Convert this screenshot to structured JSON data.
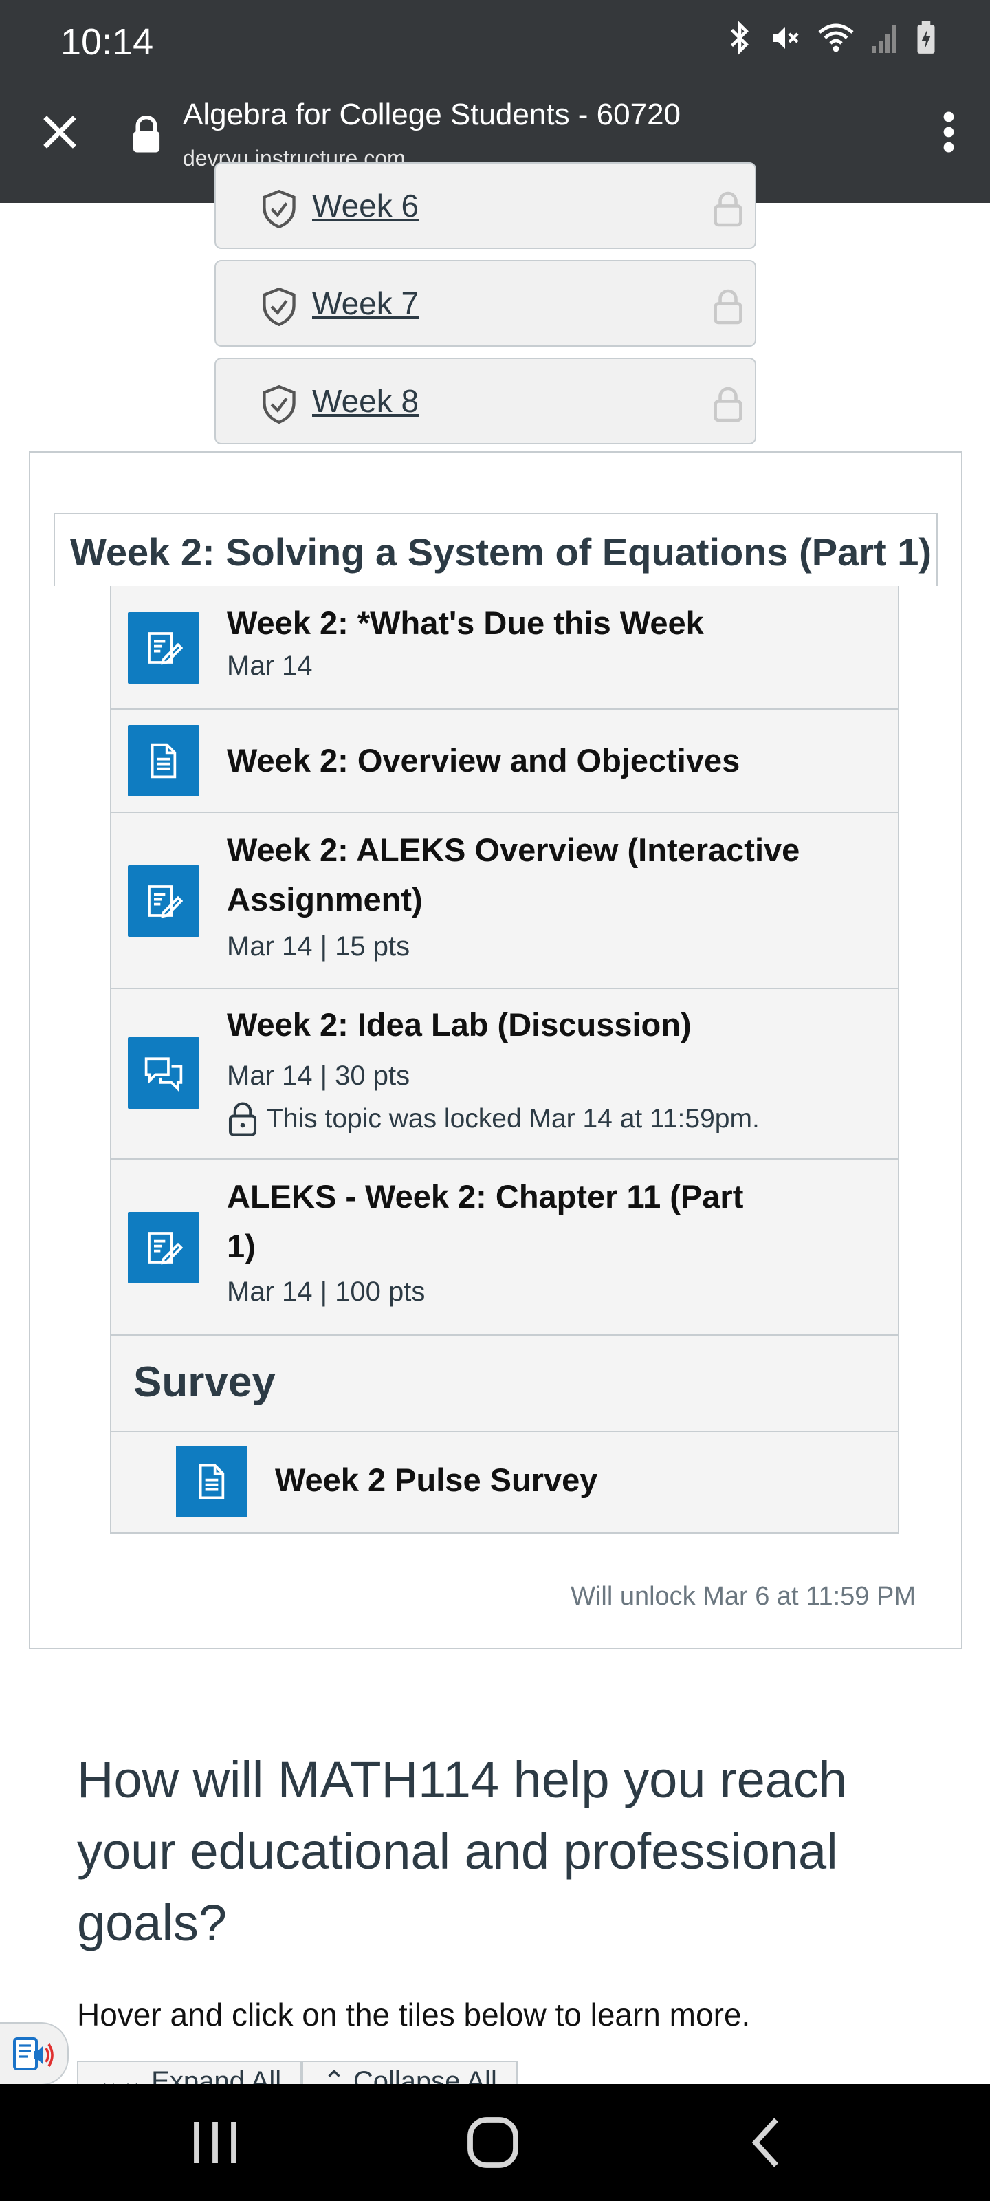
{
  "status_bar": {
    "time": "10:14",
    "icons": [
      "bluetooth-icon",
      "mute-icon",
      "wifi-icon",
      "signal-icon",
      "battery-charging-icon"
    ]
  },
  "browser": {
    "page_title": "Algebra for College Students - 60720",
    "url": "devryu.instructure.com"
  },
  "week_pills": [
    {
      "label": "Week 6",
      "locked": true
    },
    {
      "label": "Week 7",
      "locked": true
    },
    {
      "label": "Week 8",
      "locked": true
    }
  ],
  "module": {
    "title": "Week 2: Solving a System of Equations (Part 1)",
    "items": [
      {
        "title": "Week 2: *What's Due this Week",
        "meta": "Mar 14",
        "icon": "assignment-icon"
      },
      {
        "title": "Week 2: Overview and Objectives",
        "meta": "",
        "icon": "page-icon"
      },
      {
        "title_line1": "Week 2: ALEKS Overview (Interactive",
        "title_line2": "Assignment)",
        "meta": "Mar 14  |  15 pts",
        "icon": "assignment-icon"
      },
      {
        "title": "Week 2: Idea Lab (Discussion)",
        "meta": "Mar 14  |  30 pts",
        "lock_message": "This topic was locked Mar 14 at 11:59pm.",
        "icon": "discussion-icon"
      },
      {
        "title_line1": "ALEKS - Week 2: Chapter 11 (Part",
        "title_line2": "1)",
        "meta": "Mar 14  |  100 pts",
        "icon": "assignment-icon"
      }
    ],
    "survey_header": "Survey",
    "survey_item": "Week 2 Pulse Survey",
    "unlock_text": "Will unlock Mar 6 at 11:59 PM"
  },
  "content": {
    "question": "How will MATH114 help you reach your educational and professional goals?",
    "hover_text": "Hover and click on the tiles below to learn more.",
    "expand_all": "Expand All",
    "collapse_all": "Collapse All"
  },
  "colors": {
    "chrome_bg": "#35383b",
    "icon_blue": "#0f7cc1",
    "border": "#c7cdd1",
    "text": "#2d3b45"
  }
}
